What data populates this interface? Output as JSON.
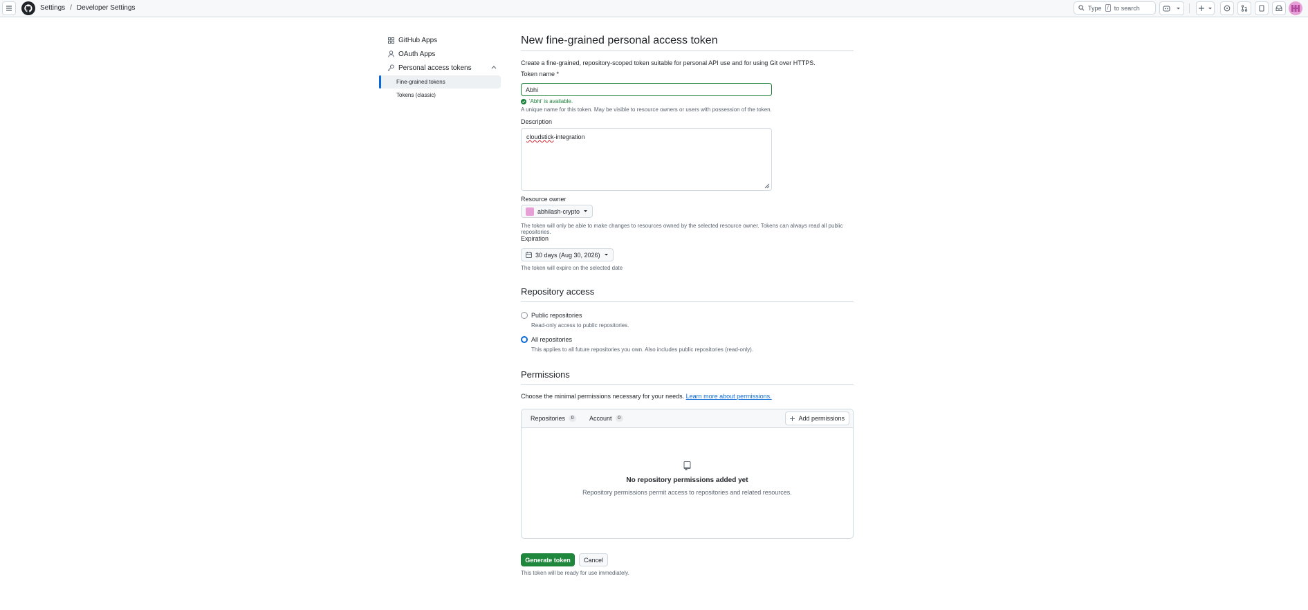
{
  "header": {
    "breadcrumbs": [
      "Settings",
      "Developer Settings"
    ],
    "breadcrumb_separator": "/",
    "search": {
      "prefix": "Type",
      "key": "/",
      "suffix": "to search"
    },
    "icons": [
      "menu-icon",
      "github-logo-icon",
      "search-icon",
      "copilot-icon",
      "chevron-down-icon",
      "plus-icon",
      "issues-icon",
      "pull-requests-icon",
      "discussions-icon",
      "inbox-icon",
      "avatar"
    ]
  },
  "sidebar": {
    "items": [
      {
        "label": "GitHub Apps",
        "icon": "apps-icon"
      },
      {
        "label": "OAuth Apps",
        "icon": "person-icon"
      },
      {
        "label": "Personal access tokens",
        "icon": "key-icon"
      }
    ],
    "subitems": [
      {
        "label": "Fine-grained tokens",
        "active": true
      },
      {
        "label": "Tokens (classic)",
        "active": false
      }
    ]
  },
  "main": {
    "title": "New fine-grained personal access token",
    "intro": "Create a fine-grained, repository-scoped token suitable for personal API use and for using Git over HTTPS.",
    "token_name": {
      "label": "Token name *",
      "value": "Abhi",
      "valid_message": "'Abhi' is available.",
      "hint": "A unique name for this token. May be visible to resource owners or users with possession of the token."
    },
    "description": {
      "label": "Description",
      "value_misspelled": "cloudstick",
      "value_rest": "-integration"
    },
    "resource_owner": {
      "label": "Resource owner",
      "value": "abhilash-crypto",
      "hint": "The token will only be able to make changes to resources owned by the selected resource owner. Tokens can always read all public repositories."
    },
    "expiration": {
      "label": "Expiration",
      "value": "30 days (Aug 30, 2026)",
      "hint": "The token will expire on the selected date"
    },
    "repository_access": {
      "title": "Repository access",
      "options": [
        {
          "label": "Public repositories",
          "desc": "Read-only access to public repositories.",
          "checked": false
        },
        {
          "label": "All repositories",
          "desc": "This applies to all future repositories you own. Also includes public repositories (read-only).",
          "checked": true
        }
      ]
    },
    "permissions": {
      "title": "Permissions",
      "intro": "Choose the minimal permissions necessary for your needs.",
      "learn_more": "Learn more about permissions.",
      "tabs": [
        {
          "label": "Repositories",
          "count": "0"
        },
        {
          "label": "Account",
          "count": "0"
        }
      ],
      "add_button": "Add permissions",
      "empty_title": "No repository permissions added yet",
      "empty_desc": "Repository permissions permit access to repositories and related resources."
    },
    "actions": {
      "generate": "Generate token",
      "cancel": "Cancel",
      "note": "This token will be ready for use immediately."
    }
  },
  "colors": {
    "primary_green": "#1f883d",
    "link_blue": "#0969da",
    "valid_green": "#1a7f37",
    "avatar_pink": "#e7a0d6"
  }
}
